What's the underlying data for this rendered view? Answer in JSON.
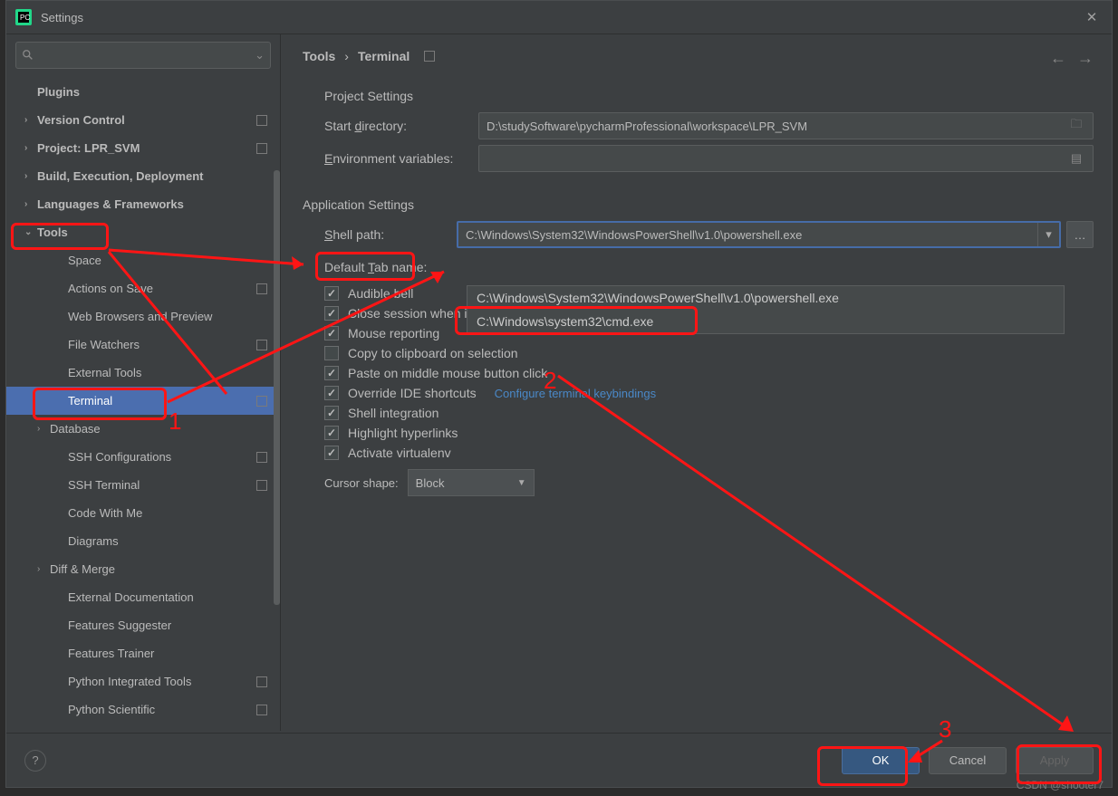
{
  "window": {
    "title": "Settings"
  },
  "search": {
    "placeholder": ""
  },
  "breadcrumb": {
    "parent": "Tools",
    "current": "Terminal"
  },
  "sidebar": {
    "items": [
      {
        "label": "Plugins",
        "bold": true,
        "indent": 0,
        "chev": ""
      },
      {
        "label": "Version Control",
        "bold": true,
        "indent": 0,
        "chev": "›",
        "sq": true
      },
      {
        "label": "Project: LPR_SVM",
        "bold": true,
        "indent": 0,
        "chev": "›",
        "sq": true
      },
      {
        "label": "Build, Execution, Deployment",
        "bold": true,
        "indent": 0,
        "chev": "›"
      },
      {
        "label": "Languages & Frameworks",
        "bold": true,
        "indent": 0,
        "chev": "›"
      },
      {
        "label": "Tools",
        "bold": true,
        "indent": 0,
        "chev": "⌄"
      },
      {
        "label": "Space",
        "indent": 2
      },
      {
        "label": "Actions on Save",
        "indent": 2,
        "sq": true
      },
      {
        "label": "Web Browsers and Preview",
        "indent": 2
      },
      {
        "label": "File Watchers",
        "indent": 2,
        "sq": true
      },
      {
        "label": "External Tools",
        "indent": 2
      },
      {
        "label": "Terminal",
        "indent": 2,
        "sq": true,
        "selected": true
      },
      {
        "label": "Database",
        "indent": 1,
        "chev": "›"
      },
      {
        "label": "SSH Configurations",
        "indent": 2,
        "sq": true
      },
      {
        "label": "SSH Terminal",
        "indent": 2,
        "sq": true
      },
      {
        "label": "Code With Me",
        "indent": 2
      },
      {
        "label": "Diagrams",
        "indent": 2
      },
      {
        "label": "Diff & Merge",
        "indent": 1,
        "chev": "›"
      },
      {
        "label": "External Documentation",
        "indent": 2
      },
      {
        "label": "Features Suggester",
        "indent": 2
      },
      {
        "label": "Features Trainer",
        "indent": 2
      },
      {
        "label": "Python Integrated Tools",
        "indent": 2,
        "sq": true
      },
      {
        "label": "Python Scientific",
        "indent": 2,
        "sq": true
      }
    ]
  },
  "sections": {
    "project": "Project Settings",
    "application": "Application Settings"
  },
  "fields": {
    "start_dir_label": "Start directory:",
    "start_dir_value": "D:\\studySoftware\\pycharmProfessional\\workspace\\LPR_SVM",
    "env_label": "Environment variables:",
    "env_value": "",
    "shell_label": "Shell path:",
    "shell_value": "C:\\Windows\\System32\\WindowsPowerShell\\v1.0\\powershell.exe",
    "shell_options": [
      "C:\\Windows\\System32\\WindowsPowerShell\\v1.0\\powershell.exe",
      "C:\\Windows\\system32\\cmd.exe"
    ],
    "tab_name_label": "Default Tab name:",
    "tab_name_value": "",
    "cursor_label": "Cursor shape:",
    "cursor_value": "Block"
  },
  "checks": {
    "audible": "Audible bell",
    "close_session": "Close session when it ends",
    "mouse": "Mouse reporting",
    "copy": "Copy to clipboard on selection",
    "paste": "Paste on middle mouse button click",
    "override": "Override IDE shortcuts",
    "override_link": "Configure terminal keybindings",
    "shell_int": "Shell integration",
    "highlight": "Highlight hyperlinks",
    "venv": "Activate virtualenv"
  },
  "buttons": {
    "ok": "OK",
    "cancel": "Cancel",
    "apply": "Apply"
  },
  "annotations": {
    "n1": "1",
    "n2": "2",
    "n3": "3"
  },
  "watermark": "CSDN @shooter7"
}
